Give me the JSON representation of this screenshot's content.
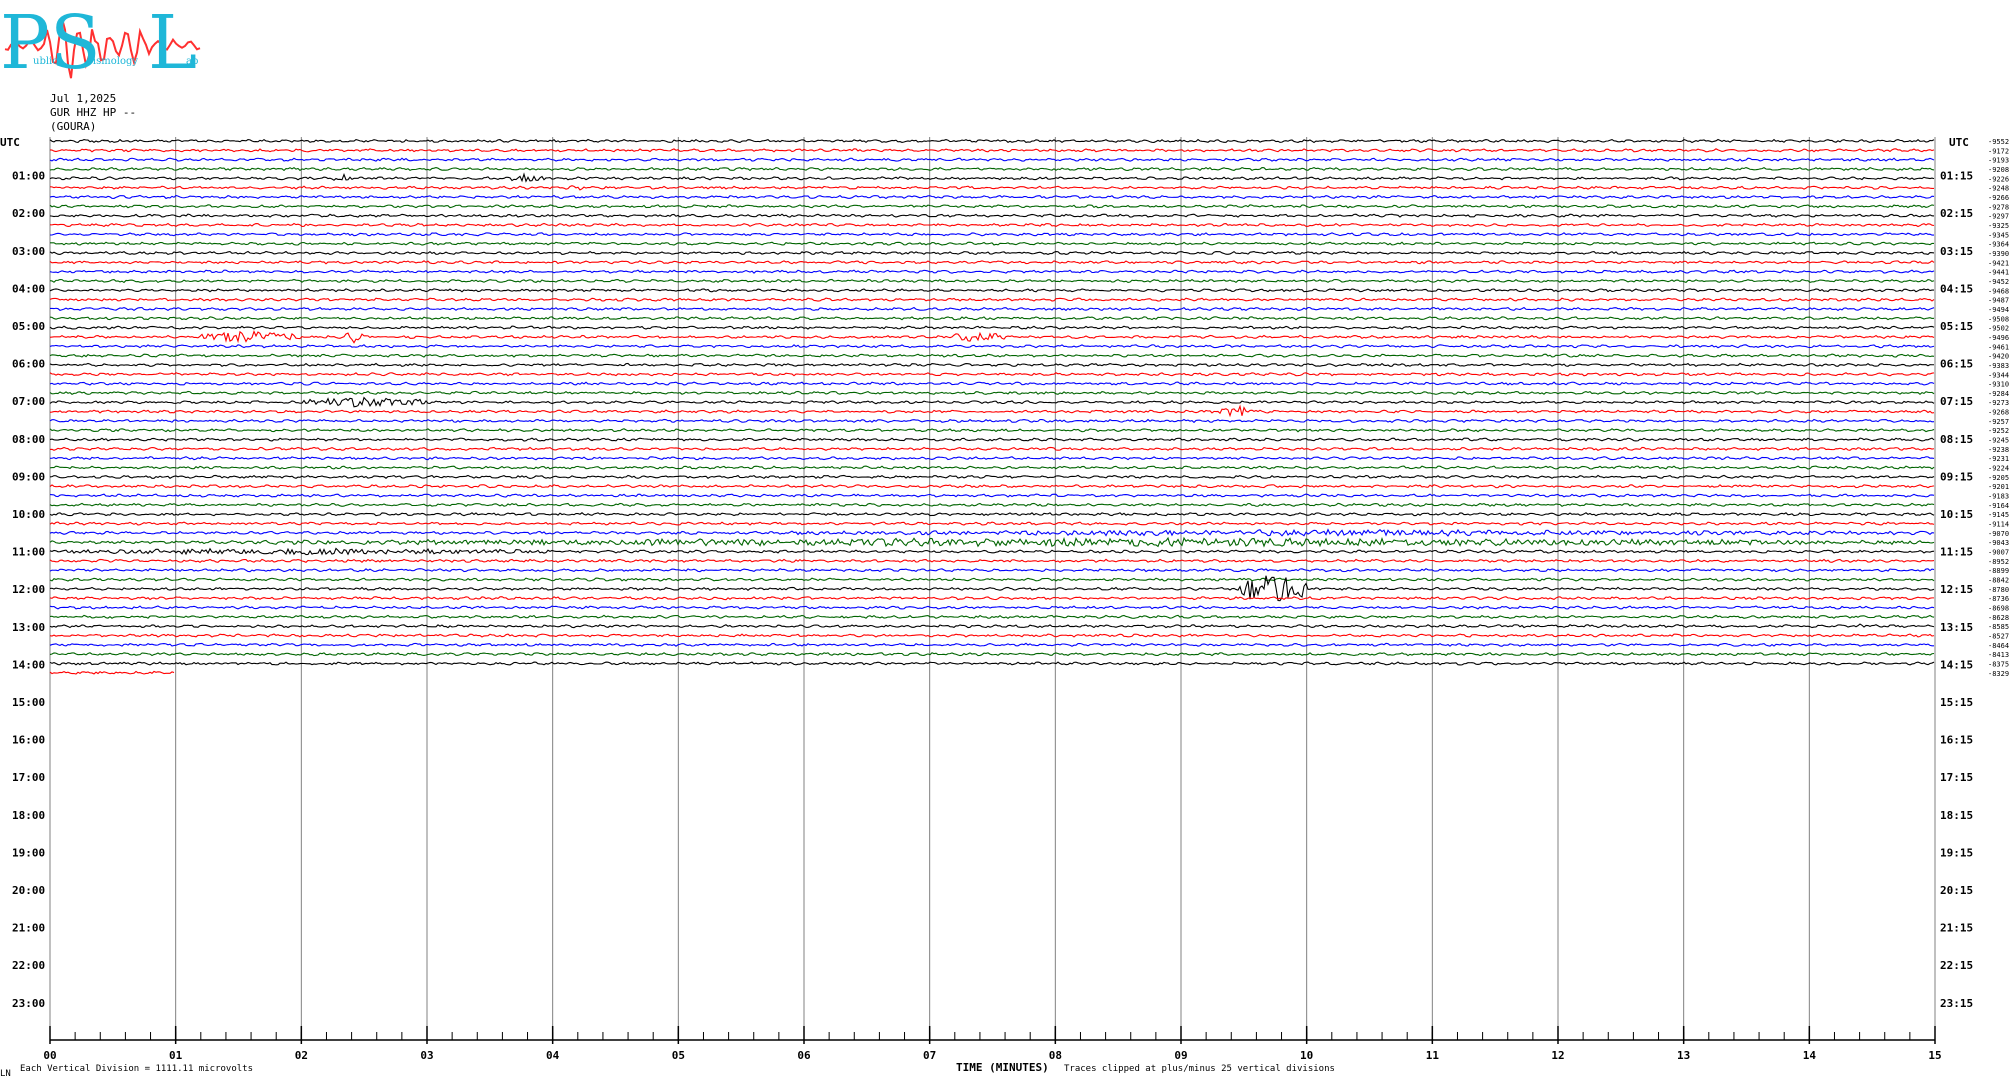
{
  "logo": {
    "letters": [
      "P",
      "S",
      "L"
    ],
    "words": [
      "ublic",
      "eismology",
      "ab"
    ],
    "colors": {
      "text": "#1fb7d8",
      "wave": "#ff3030"
    }
  },
  "header": {
    "date": "Jul 1,2025",
    "station": "GUR HHZ HP --",
    "site": "(GOURA)"
  },
  "utc_label_left": "UTC",
  "utc_label_right": "UTC",
  "footer": {
    "left_mark": "LN",
    "scale_note": "Each Vertical Division = 1111.11 microvolts",
    "xlabel": "TIME (MINUTES)",
    "clip_note": "Traces clipped at plus/minus 25 vertical divisions"
  },
  "chart_data": {
    "type": "line",
    "title": "",
    "xlabel": "TIME (MINUTES)",
    "ylabel": "UTC",
    "xlim": [
      0,
      15
    ],
    "x_ticks": [
      "00",
      "01",
      "02",
      "03",
      "04",
      "05",
      "06",
      "07",
      "08",
      "09",
      "10",
      "11",
      "12",
      "13",
      "14",
      "15"
    ],
    "left_hour_labels": [
      "01:00",
      "02:00",
      "03:00",
      "04:00",
      "05:00",
      "06:00",
      "07:00",
      "08:00",
      "09:00",
      "10:00",
      "11:00",
      "12:00",
      "13:00",
      "14:00",
      "15:00",
      "16:00",
      "17:00",
      "18:00",
      "19:00",
      "20:00",
      "21:00",
      "22:00",
      "23:00"
    ],
    "right_hour_labels": [
      "01:15",
      "02:15",
      "03:15",
      "04:15",
      "05:15",
      "06:15",
      "07:15",
      "08:15",
      "09:15",
      "10:15",
      "11:15",
      "12:15",
      "13:15",
      "14:15",
      "15:15",
      "16:15",
      "17:15",
      "18:15",
      "19:15",
      "20:15",
      "21:15",
      "22:15",
      "23:15"
    ],
    "trace_offsets": [
      "-9552",
      "-9172",
      "-9193",
      "-9208",
      "-9226",
      "-9248",
      "-9266",
      "-9278",
      "-9297",
      "-9325",
      "-9345",
      "-9364",
      "-9390",
      "-9421",
      "-9441",
      "-9452",
      "-9468",
      "-9487",
      "-9494",
      "-9508",
      "-9502",
      "-9496",
      "-9461",
      "-9420",
      "-9383",
      "-9344",
      "-9310",
      "-9284",
      "-9273",
      "-9268",
      "-9257",
      "-9252",
      "-9245",
      "-9238",
      "-9231",
      "-9224",
      "-9205",
      "-9201",
      "-9183",
      "-9164",
      "-9145",
      "-9114",
      "-9070",
      "-9043",
      "-9007",
      "-8952",
      "-8899",
      "-8842",
      "-8780",
      "-8736",
      "-8698",
      "-8628",
      "-8585",
      "-8527",
      "-8464",
      "-8413",
      "-8375",
      "-8329"
    ],
    "trace_colors": [
      "#000000",
      "#ff0000",
      "#0000ff",
      "#006400"
    ],
    "trace_minutes_per_line": 15,
    "last_trace_end_minute": 1,
    "events": [
      {
        "trace": 4,
        "x_min": 2.25,
        "x_max": 2.4,
        "amp": 4
      },
      {
        "trace": 4,
        "x_min": 3.6,
        "x_max": 4.0,
        "amp": 4
      },
      {
        "trace": 5,
        "x_min": 4.1,
        "x_max": 4.25,
        "amp": 3
      },
      {
        "trace": 21,
        "x_min": 1.2,
        "x_max": 2.0,
        "amp": 6
      },
      {
        "trace": 21,
        "x_min": 2.35,
        "x_max": 2.5,
        "amp": 6
      },
      {
        "trace": 21,
        "x_min": 7.1,
        "x_max": 7.6,
        "amp": 5
      },
      {
        "trace": 28,
        "x_min": 2.0,
        "x_max": 3.0,
        "amp": 5
      },
      {
        "trace": 29,
        "x_min": 9.3,
        "x_max": 9.6,
        "amp": 6
      },
      {
        "trace": 42,
        "x_min": 5.9,
        "x_max": 14.9,
        "amp": 3
      },
      {
        "trace": 43,
        "x_min": 1.6,
        "x_max": 14.9,
        "amp": 4
      },
      {
        "trace": 44,
        "x_min": 0.0,
        "x_max": 4.0,
        "amp": 3
      },
      {
        "trace": 48,
        "x_min": 9.45,
        "x_max": 10.0,
        "amp": 16
      },
      {
        "trace": 52,
        "x_min": 14.35,
        "x_max": 14.5,
        "amp": 3
      }
    ]
  }
}
